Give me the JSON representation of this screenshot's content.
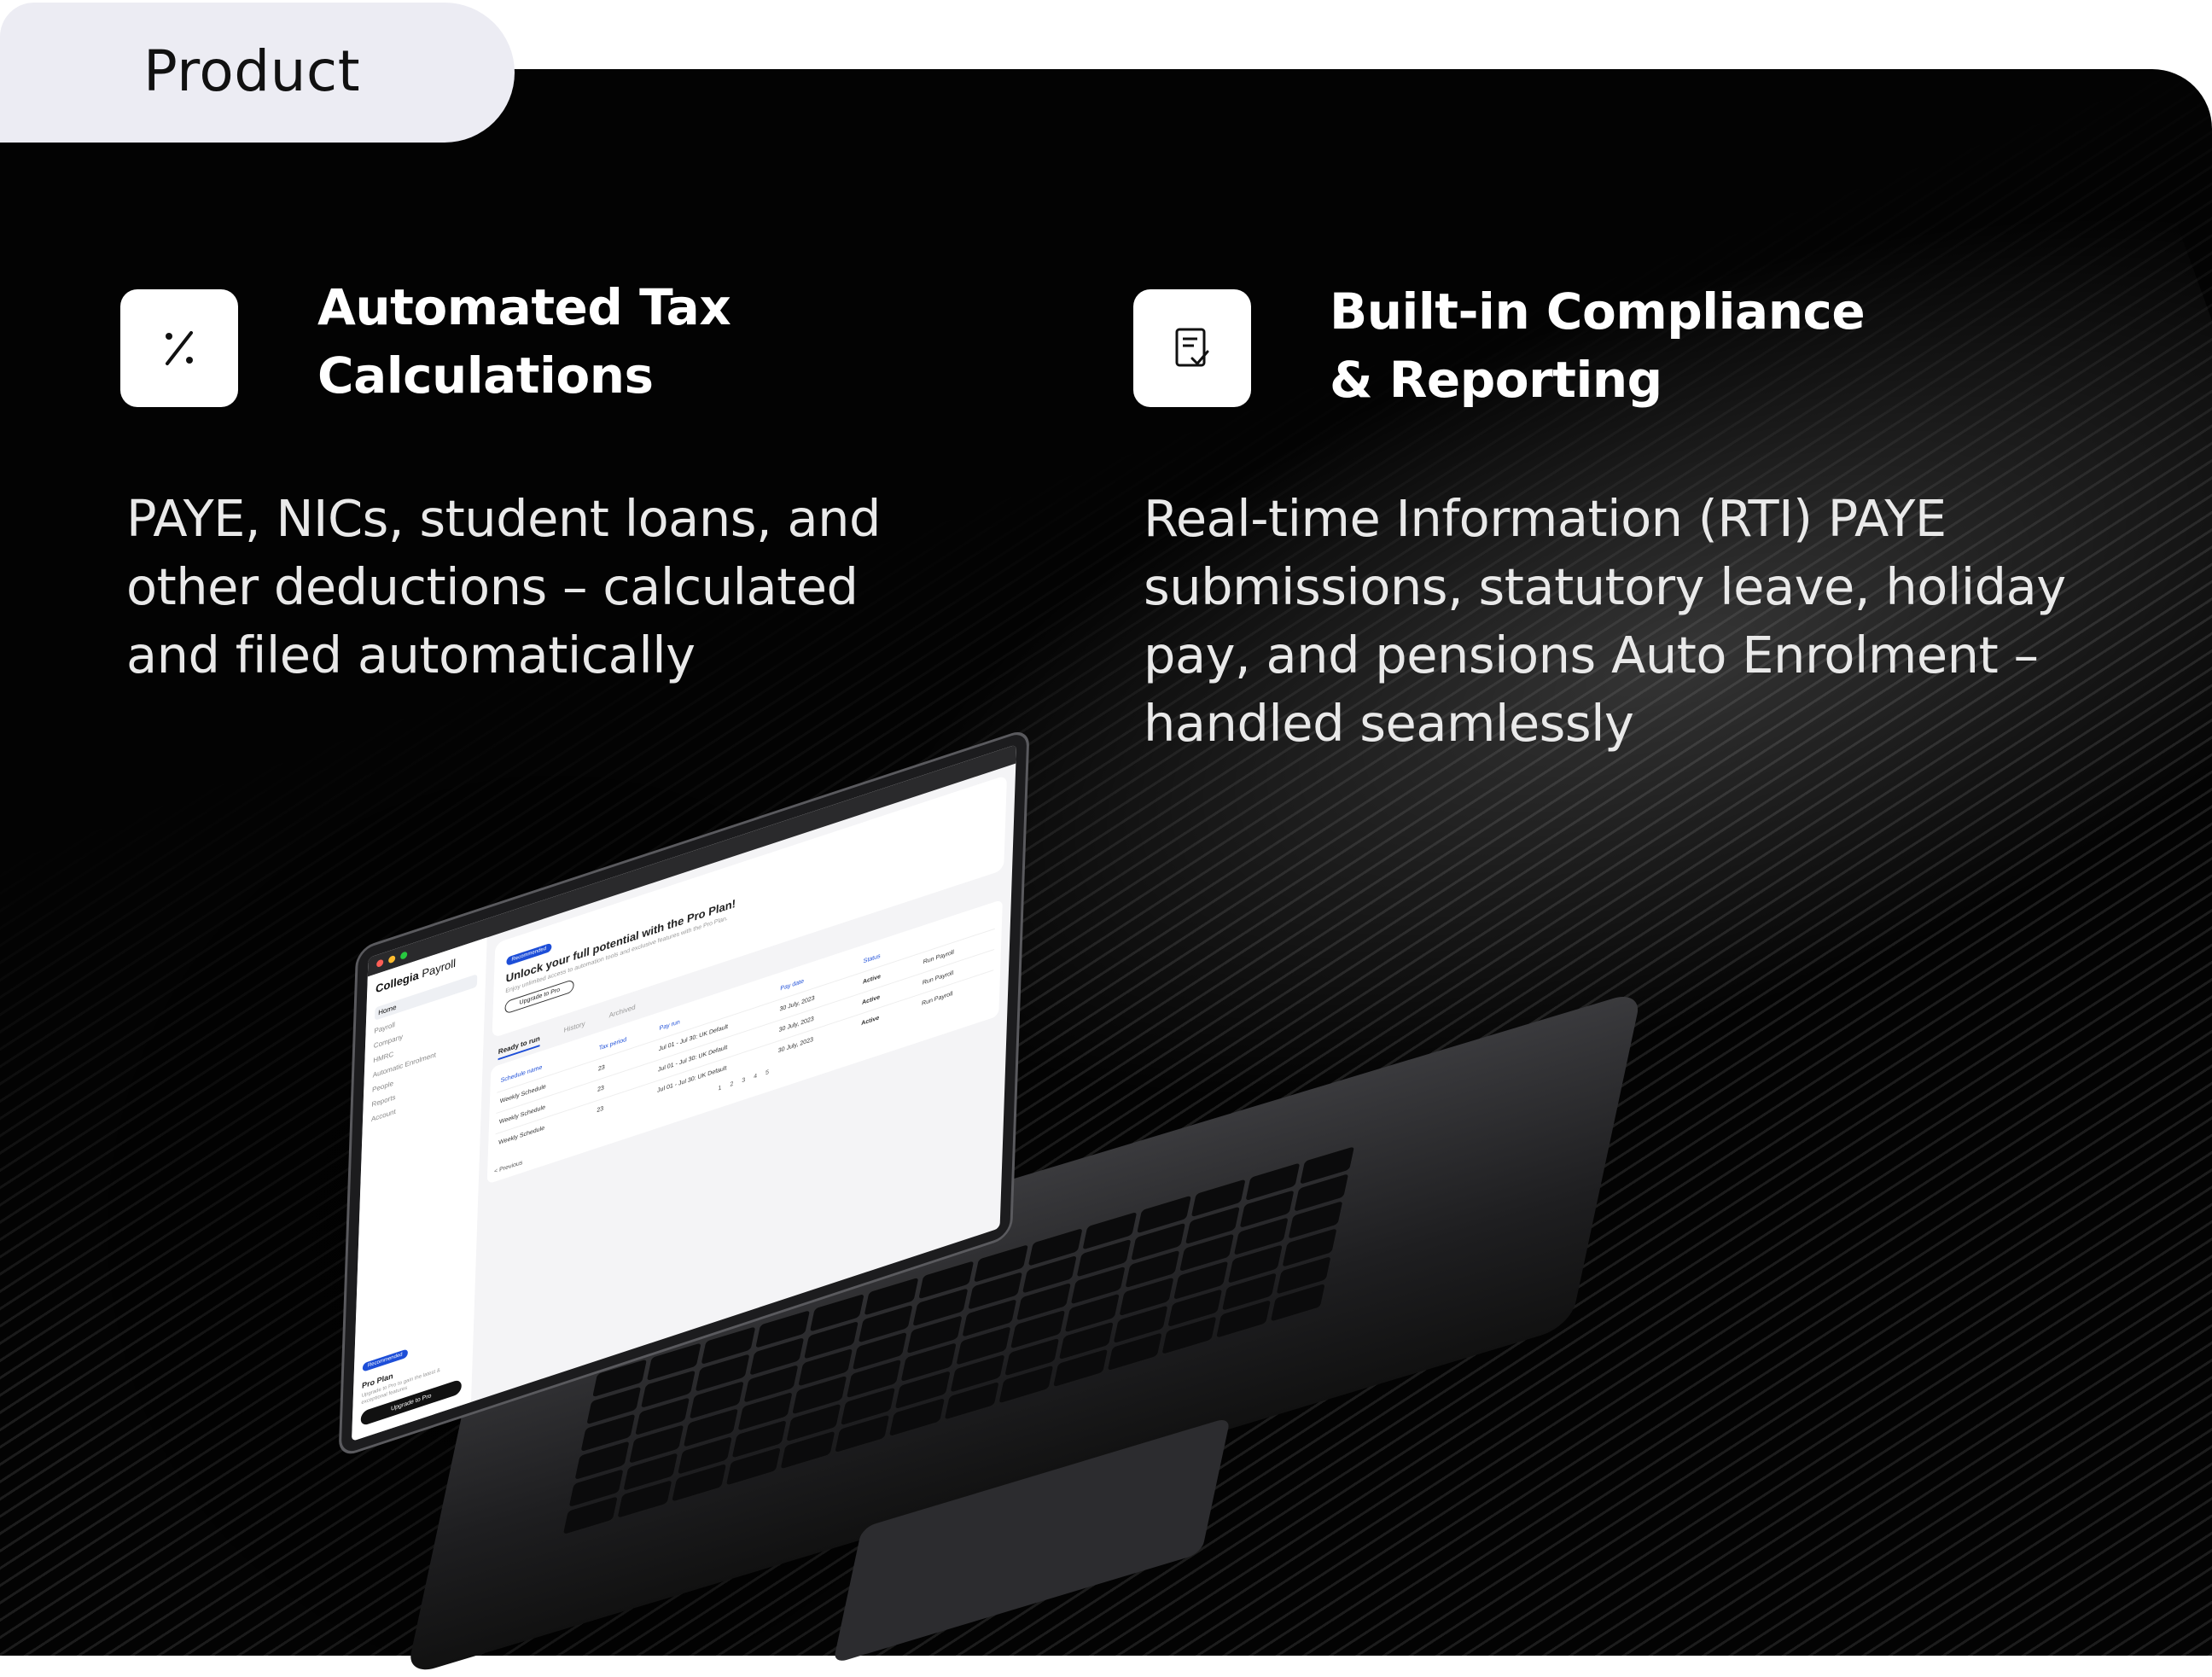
{
  "tab": {
    "label": "Product"
  },
  "features": [
    {
      "icon": "percent-icon",
      "title_lines": [
        "Automated Tax",
        "Calculations"
      ],
      "desc_lines": [
        "PAYE, NICs, student loans, and",
        "other deductions – calculated",
        "and filed automatically"
      ]
    },
    {
      "icon": "checklist-document-icon",
      "title_lines": [
        "Built-in Compliance",
        "& Reporting"
      ],
      "desc_lines": [
        "Real-time Information (RTI) PAYE",
        "submissions, statutory leave, holiday",
        "pay, and pensions Auto Enrolment –",
        "handled seamlessly"
      ]
    }
  ],
  "app": {
    "brand_bold": "Collegia",
    "brand_light": "Payroll",
    "sidebar": [
      "Home",
      "Payroll",
      "Company",
      "HMRC",
      "Automatic Enrolment",
      "People",
      "Reports",
      "Account"
    ],
    "pro_badge": "Recommended",
    "pro_title": "Pro Plan",
    "pro_text": "Upgrade to Pro to gain the latest & exceptional features",
    "pro_button": "Upgrade to Pro",
    "banner_badge": "Recommended",
    "banner_title": "Unlock your full potential with the Pro Plan!",
    "banner_text": "Enjoy unlimited access to automation tools and exclusive features with the Pro Plan.",
    "banner_button": "Upgrade to Pro",
    "tabs": [
      "Ready to run",
      "History",
      "Archived"
    ],
    "columns": [
      "Schedule name",
      "Tax period",
      "Pay run",
      "Pay date",
      "Status",
      ""
    ],
    "rows": [
      [
        "Weekly Schedule",
        "23",
        "Jul 01 - Jul 30: UK Default",
        "30 July, 2023",
        "Active",
        "Run Payroll"
      ],
      [
        "Weekly Schedule",
        "23",
        "Jul 01 - Jul 30: UK Default",
        "30 July, 2023",
        "Active",
        "Run Payroll"
      ],
      [
        "Weekly Schedule",
        "23",
        "Jul 01 - Jul 30: UK Default",
        "30 July, 2023",
        "Active",
        "Run Payroll"
      ]
    ],
    "pages": [
      "1",
      "2",
      "3",
      "4",
      "5"
    ],
    "prev": "< Previous"
  }
}
